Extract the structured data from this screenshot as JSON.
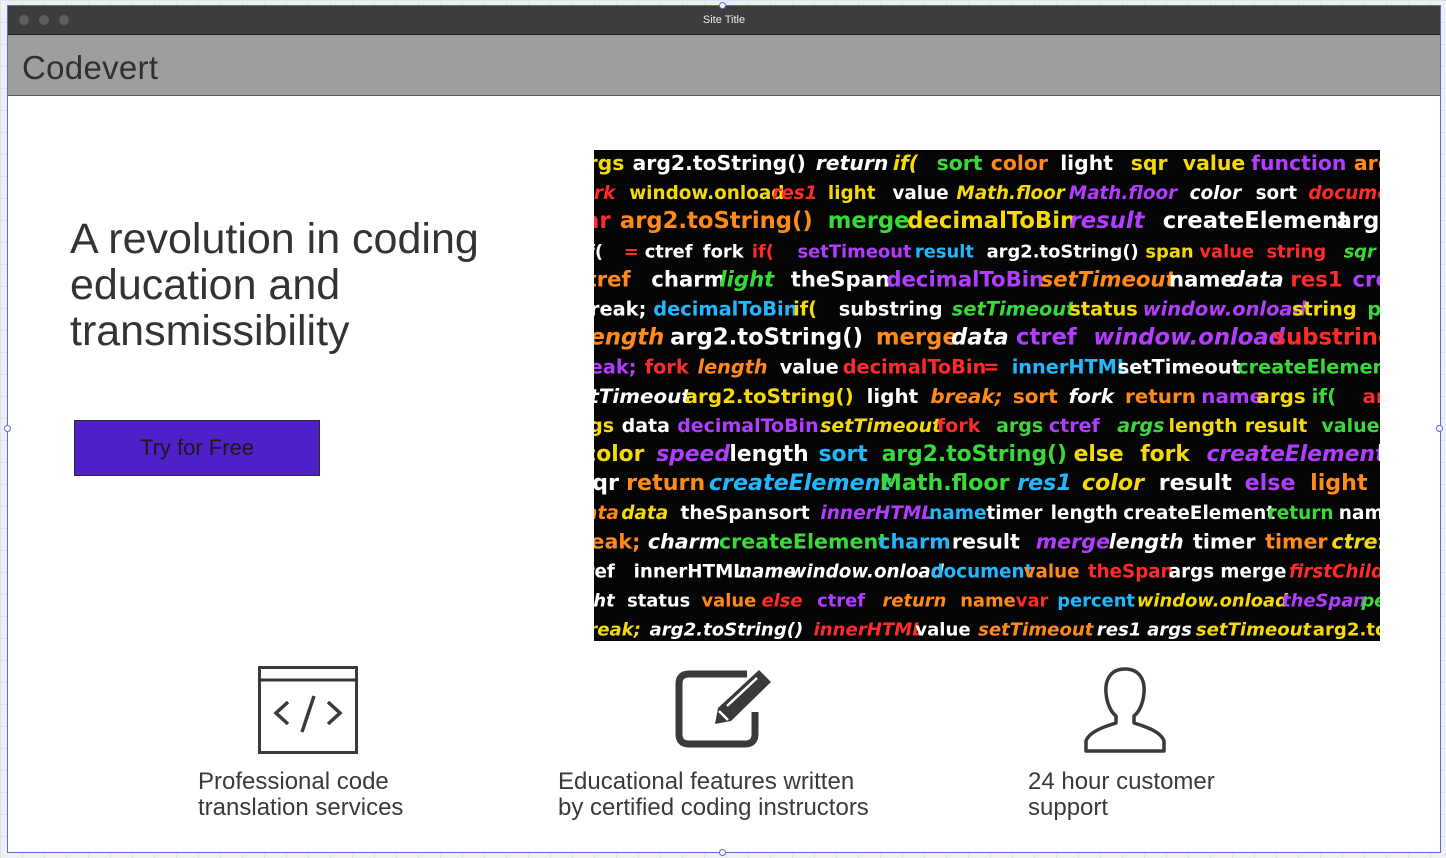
{
  "window": {
    "title": "Site Title"
  },
  "header": {
    "logo": "Codevert"
  },
  "hero": {
    "headline": "A revolution in coding education and transmissibility",
    "cta_label": "Try for Free",
    "accent_color": "#4f1fc7"
  },
  "features": [
    {
      "icon": "code-window-icon",
      "label": "Professional code\ntranslation services"
    },
    {
      "icon": "edit-pencil-icon",
      "label": "Educational features written\nby certified coding instructors"
    },
    {
      "icon": "user-person-icon",
      "label": "24 hour customer\nsupport"
    }
  ]
}
